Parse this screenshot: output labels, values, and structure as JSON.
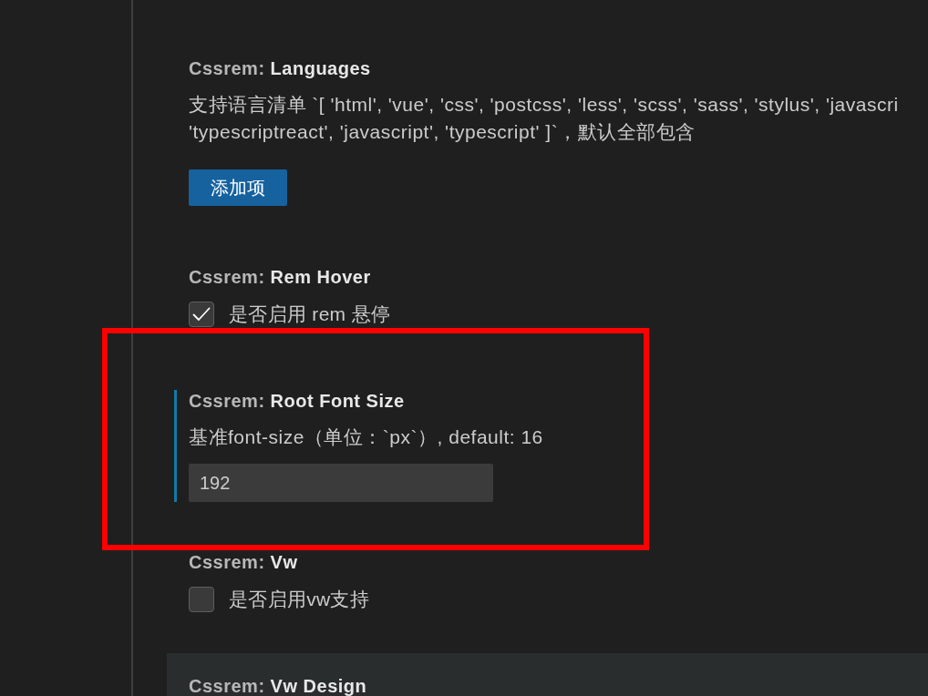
{
  "settings": [
    {
      "kind": "array",
      "category": "Cssrem:",
      "name": "Languages",
      "description_lines": [
        "支持语言清单 `[ 'html', 'vue', 'css', 'postcss', 'less', 'scss', 'sass', 'stylus', 'javascri",
        "'typescriptreact', 'javascript', 'typescript' ]`，默认全部包含"
      ],
      "button": {
        "label": "添加项"
      },
      "focused": false,
      "hovered": false,
      "annotated": false
    },
    {
      "kind": "checkbox",
      "category": "Cssrem:",
      "name": "Rem Hover",
      "checkbox": {
        "label": "是否启用 rem 悬停",
        "checked": true
      },
      "focused": false,
      "hovered": false,
      "annotated": false
    },
    {
      "kind": "number",
      "category": "Cssrem:",
      "name": "Root Font Size",
      "description_lines": [
        "基准font-size（单位：`px`）, default: 16"
      ],
      "input": {
        "value": "192"
      },
      "focused": true,
      "hovered": false,
      "annotated": true
    },
    {
      "kind": "checkbox",
      "category": "Cssrem:",
      "name": "Vw",
      "checkbox": {
        "label": "是否启用vw支持",
        "checked": false
      },
      "focused": false,
      "hovered": false,
      "annotated": false
    },
    {
      "kind": "number",
      "category": "Cssrem:",
      "name": "Vw Design",
      "focused": false,
      "hovered": true,
      "annotated": false
    }
  ]
}
